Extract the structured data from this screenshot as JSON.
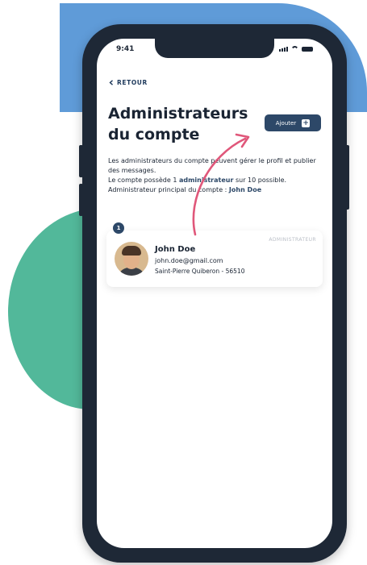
{
  "status_bar": {
    "time": "9:41"
  },
  "nav": {
    "back_label": "RETOUR"
  },
  "page": {
    "title": "Administrateurs du compte",
    "add_button_label": "Ajouter"
  },
  "description": {
    "line1": "Les administrateurs du compte peuvent gérer le profil et publier des messages.",
    "line2_prefix": "Le compte possède 1 ",
    "line2_accent": "administrateur",
    "line2_suffix": " sur 10 possible.",
    "line3_prefix": "Administrateur principal du compte : ",
    "line3_accent": "John Doe"
  },
  "admins": [
    {
      "index": "1",
      "role": "ADMINISTRATEUR",
      "name": "John Doe",
      "email": "john.doe@gmail.com",
      "address": "Saint-Pierre Quiberon - 56510"
    }
  ],
  "colors": {
    "accent": "#2d4868",
    "annotation_arrow": "#e0577a",
    "background_blue": "#5f9bd8",
    "background_green": "#52b89a",
    "phone_frame": "#1e2836"
  },
  "icons": [
    "chevron-left-icon",
    "plus-icon",
    "signal-icon",
    "wifi-icon",
    "battery-icon"
  ]
}
